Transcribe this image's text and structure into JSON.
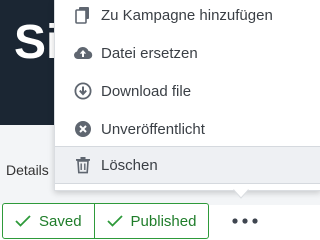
{
  "header": {
    "title_fragment": "Si"
  },
  "tabs": {
    "details_label": "Details"
  },
  "context_menu": {
    "items": [
      {
        "label": "Zu Kampagne hinzufügen",
        "icon": "copy-icon"
      },
      {
        "label": "Datei ersetzen",
        "icon": "cloud-upload-icon"
      },
      {
        "label": "Download file",
        "icon": "download-circle-icon"
      },
      {
        "label": "Unveröffentlicht",
        "icon": "x-circle-icon"
      },
      {
        "label": "Löschen",
        "icon": "trash-icon"
      }
    ],
    "selected_index": 4
  },
  "status": {
    "saved_label": "Saved",
    "published_label": "Published",
    "accent_color": "#2e9a3a"
  },
  "more_button": {
    "icon": "more-dots-icon"
  }
}
